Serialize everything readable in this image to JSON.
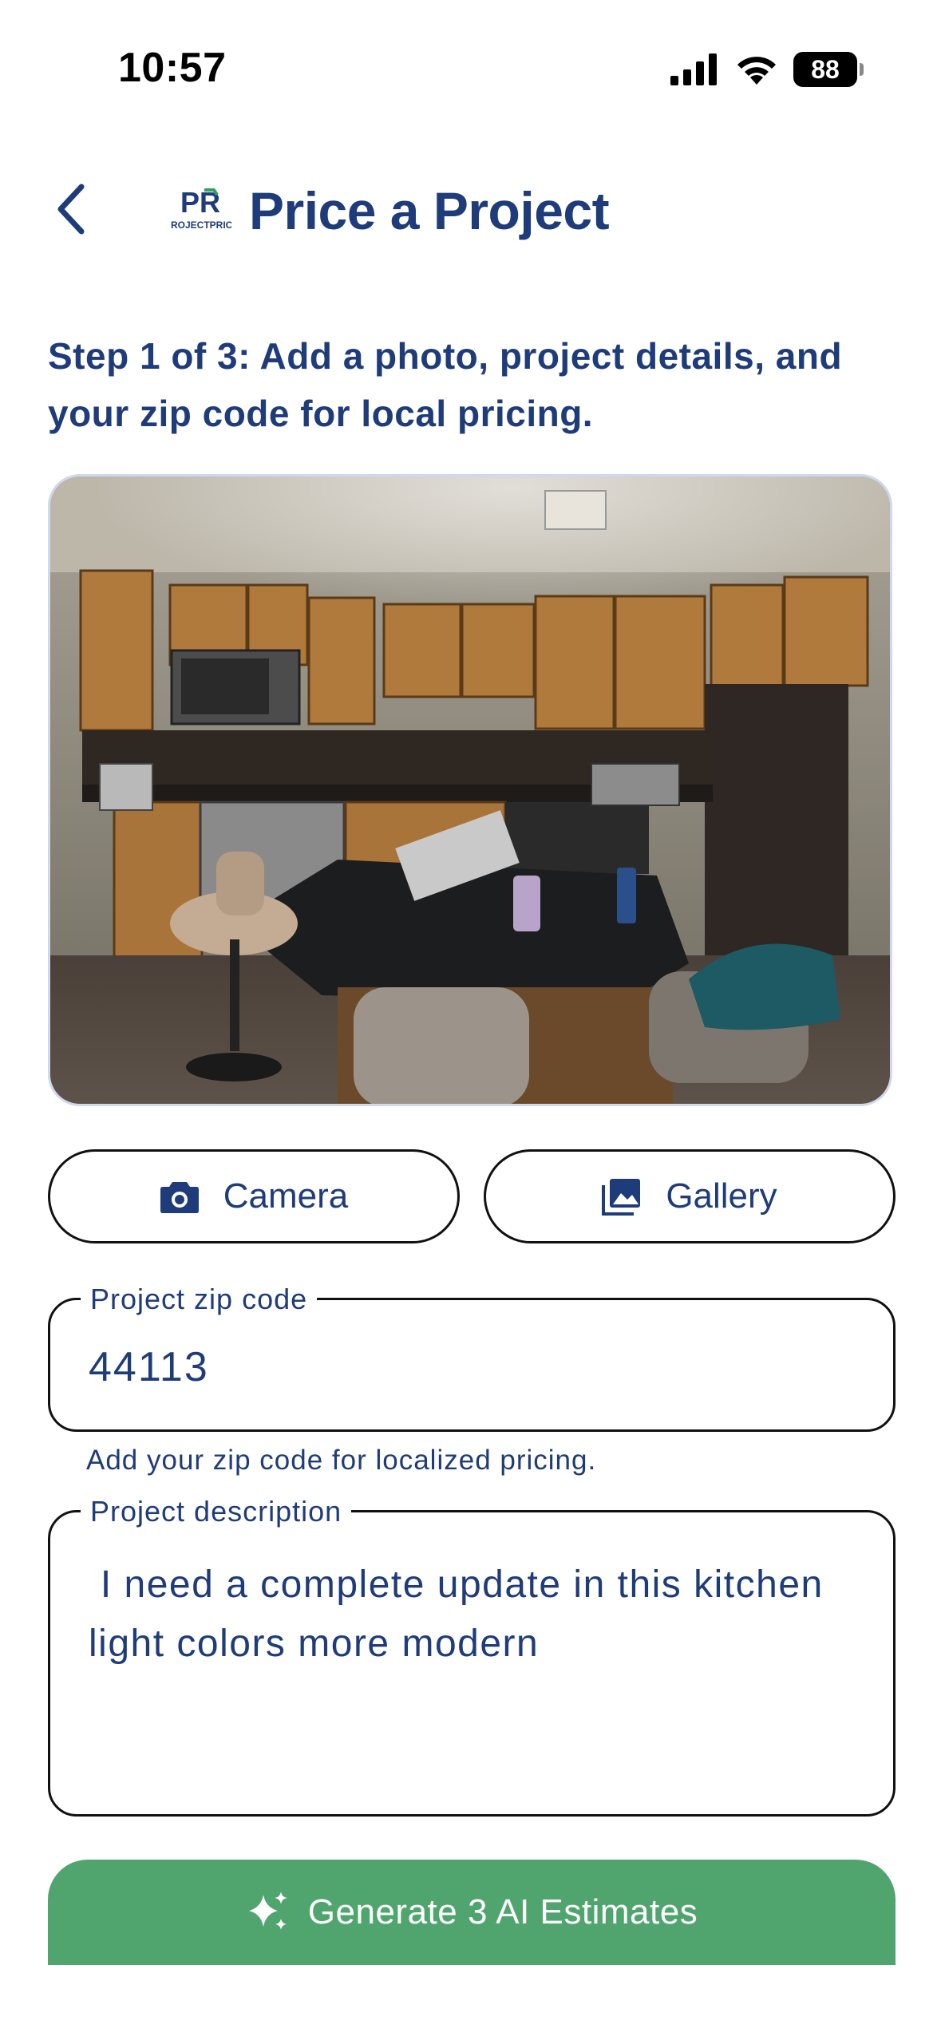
{
  "status_bar": {
    "time": "10:57",
    "battery": "88"
  },
  "header": {
    "title": "Price a Project",
    "logo_text": "ROJECTPRIC",
    "logo_mark": "PR"
  },
  "step_text": "Step 1 of 3: Add a photo, project details, and your zip code for local pricing.",
  "buttons": {
    "camera": "Camera",
    "gallery": "Gallery",
    "generate": "Generate 3 AI Estimates"
  },
  "zip_field": {
    "label": "Project zip code",
    "value": "44113",
    "help": "Add your zip code for localized pricing."
  },
  "description_field": {
    "label": "Project description",
    "value": " I need a complete update in this kitchen light colors more modern"
  },
  "icons": {
    "back": "chevron-left-icon",
    "camera": "camera-icon",
    "gallery": "image-icon",
    "generate": "sparkles-icon"
  },
  "colors": {
    "primary": "#1f3c7a",
    "accent": "#4fa56d",
    "logo_green": "#2fa060"
  }
}
